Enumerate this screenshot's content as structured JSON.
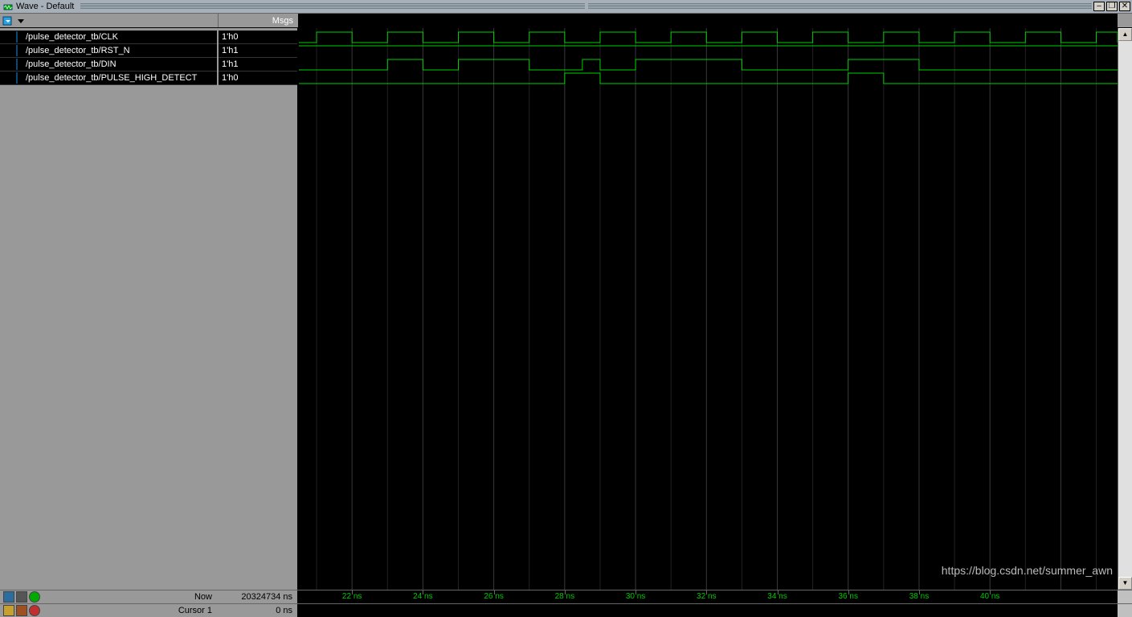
{
  "window": {
    "title": "Wave - Default"
  },
  "headers": {
    "msgs": "Msgs"
  },
  "signals": [
    {
      "name": "/pulse_detector_tb/CLK",
      "value": "1'h0"
    },
    {
      "name": "/pulse_detector_tb/RST_N",
      "value": "1'h1"
    },
    {
      "name": "/pulse_detector_tb/DIN",
      "value": "1'h1"
    },
    {
      "name": "/pulse_detector_tb/PULSE_HIGH_DETECT",
      "value": "1'h0"
    }
  ],
  "footer": {
    "now_label": "Now",
    "now_value": "20324734 ns",
    "cursor_label": "Cursor 1",
    "cursor_value": "0 ns"
  },
  "time_axis": {
    "ticks": [
      "22 ns",
      "24 ns",
      "26 ns",
      "28 ns",
      "30 ns",
      "32 ns",
      "34 ns",
      "36 ns",
      "38 ns",
      "40 ns"
    ],
    "start_ns": 20.5,
    "end_ns": 43.6,
    "major_every_ns": 2
  },
  "waveforms": {
    "clk_period_ns": 2,
    "clk": [
      0,
      1,
      0,
      1,
      0,
      1,
      0,
      1,
      0,
      1,
      0,
      1,
      0,
      1,
      0,
      1,
      0,
      1,
      0,
      1,
      0,
      1,
      0,
      1
    ],
    "rst_n": {
      "goes_high_at_ns": 20.0
    },
    "din": {
      "transitions_ns": [
        [
          20.5,
          0
        ],
        [
          22,
          0
        ],
        [
          23,
          1
        ],
        [
          24,
          0
        ],
        [
          25,
          1
        ],
        [
          27,
          0
        ],
        [
          28.5,
          1
        ],
        [
          29,
          0
        ],
        [
          30,
          1
        ],
        [
          33,
          0
        ],
        [
          36,
          1
        ],
        [
          38,
          0
        ],
        [
          43.6,
          0
        ]
      ]
    },
    "phd": {
      "transitions_ns": [
        [
          20.5,
          0
        ],
        [
          28,
          1
        ],
        [
          29,
          0
        ],
        [
          36,
          1
        ],
        [
          37,
          0
        ],
        [
          43.6,
          0
        ]
      ]
    }
  },
  "watermark": "https://blog.csdn.net/summer_awn"
}
